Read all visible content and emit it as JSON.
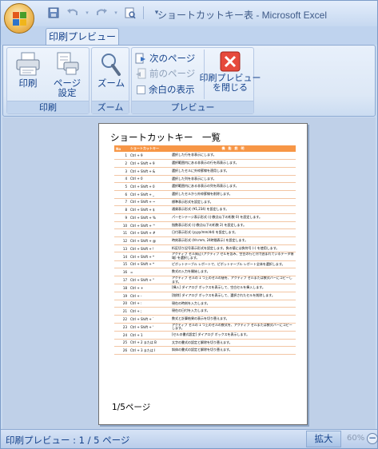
{
  "window": {
    "title": "ショートカットキー表 - Microsoft Excel"
  },
  "qat": {
    "save_icon": "save-icon",
    "undo_icon": "undo-icon",
    "redo_icon": "redo-icon",
    "print_preview_icon": "print-preview-icon",
    "customize_icon": "dropdown-icon"
  },
  "tabs": [
    {
      "label": "印刷プレビュー"
    }
  ],
  "ribbon": {
    "print_group": {
      "label": "印刷",
      "print": "印刷",
      "page_setup_1": "ページ",
      "page_setup_2": "設定"
    },
    "zoom_group": {
      "label": "ズーム",
      "zoom": "ズーム"
    },
    "preview_group": {
      "label": "プレビュー",
      "next_page": "次のページ",
      "prev_page": "前のページ",
      "show_margins": "余白の表示",
      "close_1": "印刷プレビュー",
      "close_2": "を閉じる"
    }
  },
  "sheet": {
    "title": "ショートカットキー　一覧",
    "headers": {
      "no": "No",
      "key": "ショートカットキー",
      "desc": "機　能　説　明"
    },
    "rows": [
      {
        "no": "1",
        "key": "Ctrl + 9",
        "desc": "選択した行を非表示にします。"
      },
      {
        "no": "2",
        "key": "Ctrl + Shift + 9",
        "desc": "選択範囲内にある非表示の行を再表示します。"
      },
      {
        "no": "3",
        "key": "Ctrl + Shift + &",
        "desc": "選択したセルに外枠罫線を適用します。"
      },
      {
        "no": "4",
        "key": "Ctrl + 0",
        "desc": "選択した列を非表示にします。"
      },
      {
        "no": "5",
        "key": "Ctrl + Shift + 0",
        "desc": "選択範囲内にある非表示の列を再表示します。"
      },
      {
        "no": "6",
        "key": "Ctrl + Shift + _",
        "desc": "選択したセルから外枠罫線を削除します。"
      },
      {
        "no": "7",
        "key": "Ctrl + Shift + ~",
        "desc": "標準表示形式を設定します。"
      },
      {
        "no": "8",
        "key": "Ctrl + Shift + $",
        "desc": "通貨表示形式 (¥1,234) を設定します。"
      },
      {
        "no": "9",
        "key": "Ctrl + Shift + %",
        "desc": "パーセンテージ表示形式 (小数点以下の桁数 0) を設定します。"
      },
      {
        "no": "10",
        "key": "Ctrl + Shift + ^",
        "desc": "指数表示形式 (小数点以下の桁数 2) を設定します。"
      },
      {
        "no": "11",
        "key": "Ctrl + Shift + #",
        "desc": "日付表示形式 (yyyy/mm/dd) を設定します。"
      },
      {
        "no": "12",
        "key": "Ctrl + Shift + @",
        "desc": "時刻表示形式 (hh:mm, 24時間表示) を設定します。"
      },
      {
        "no": "13",
        "key": "Ctrl + Shift + !",
        "desc": "桁区切り記号表示形式を設定します。負の値には負符号 (-) を使用します。"
      },
      {
        "no": "14",
        "key": "Ctrl + Shift + *",
        "desc": "アクティブ セル周辺 (アクティブ セルを含み、空白の行と列で囲まれているデータ領域) を選択します。"
      },
      {
        "no": "15",
        "key": "Ctrl + Shift + *",
        "desc": "ピボットテーブル レポートで、ピボットテーブル レポート全体を選択します。"
      },
      {
        "no": "16",
        "key": "=",
        "desc": "数式の入力を開始します。"
      },
      {
        "no": "17",
        "key": "Ctrl + Shift + \"",
        "desc": "アクティブ セルの 1 つ上のセルの値を、アクティブ セルまたは数式バーにコピーします。"
      },
      {
        "no": "18",
        "key": "Ctrl + +",
        "desc": "[挿入] ダイアログ ボックスを表示して、空白セルを挿入します。"
      },
      {
        "no": "19",
        "key": "Ctrl + -",
        "desc": "[削除] ダイアログ ボックスを表示して、選択されたセルを削除します。"
      },
      {
        "no": "20",
        "key": "Ctrl + :",
        "desc": "現在の時刻を入力します。"
      },
      {
        "no": "21",
        "key": "Ctrl + ;",
        "desc": "現在の日付を入力します。"
      },
      {
        "no": "22",
        "key": "Ctrl + Shift + `",
        "desc": "数式と計算結果の表示を切り替えます。"
      },
      {
        "no": "23",
        "key": "Ctrl + Shift + '",
        "desc": "アクティブ セルの 1 つ上のセルの数式を、アクティブ セルまたは数式バーにコピーします。"
      },
      {
        "no": "24",
        "key": "Ctrl + 1",
        "desc": "[セルの書式設定] ダイアログ ボックスを表示します。"
      },
      {
        "no": "25",
        "key": "Ctrl + 2 または B",
        "desc": "太字の書式の設定と解除を切り替えます。"
      },
      {
        "no": "26",
        "key": "Ctrl + 3 または I",
        "desc": "斜体の書式の設定と解除を切り替えます。"
      }
    ],
    "footer": "1/5ページ"
  },
  "status": {
    "text": "印刷プレビュー : 1 / 5 ページ",
    "zoom_button": "拡大",
    "zoom_level": "60%",
    "zoom_out": "−"
  },
  "colors": {
    "header_bg": "#f79646",
    "row_border": "#f3c6a4",
    "ribbon_text": "#15428b"
  }
}
